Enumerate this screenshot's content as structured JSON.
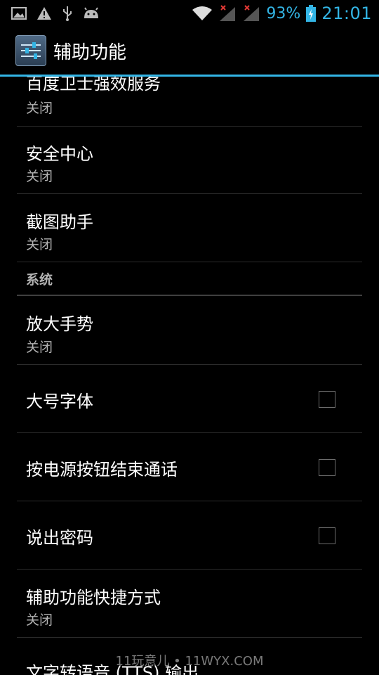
{
  "status_bar": {
    "left_icons": [
      "image-icon",
      "warning-icon",
      "usb-icon",
      "android-icon"
    ],
    "right_icons": [
      "wifi-icon",
      "signal-1-no-data-icon",
      "signal-2-no-data-icon",
      "battery-charging-icon"
    ],
    "battery_percent": "93%",
    "time": "21:01",
    "accent_color": "#33b5e5"
  },
  "action_bar": {
    "icon": "settings-sliders-icon",
    "title": "辅助功能"
  },
  "list": {
    "items": [
      {
        "title": "百度卫士强效服务",
        "summary": "关闭"
      },
      {
        "title": "安全中心",
        "summary": "关闭"
      },
      {
        "title": "截图助手",
        "summary": "关闭"
      }
    ],
    "section_system": "系统",
    "system_items": [
      {
        "title": "放大手势",
        "summary": "关闭"
      },
      {
        "title": "大号字体",
        "checked": false
      },
      {
        "title": "按电源按钮结束通话",
        "checked": false
      },
      {
        "title": "说出密码",
        "checked": false
      },
      {
        "title": "辅助功能快捷方式",
        "summary": "关闭"
      },
      {
        "title": "文字转语音 (TTS) 输出"
      }
    ]
  },
  "watermark": "11玩意儿 • 11WYX.COM"
}
